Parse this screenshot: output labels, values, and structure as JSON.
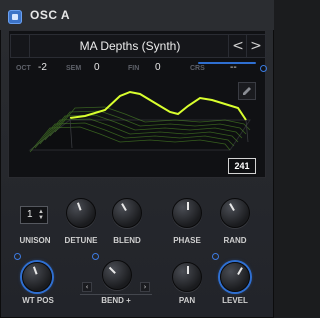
{
  "header": {
    "title": "OSC A"
  },
  "preset": {
    "name": "MA Depths (Synth)",
    "prev": "<",
    "next": ">"
  },
  "params": {
    "oct": {
      "label": "OCT",
      "value": "-2"
    },
    "sem": {
      "label": "SEM",
      "value": "0"
    },
    "fin": {
      "label": "FIN",
      "value": "0"
    },
    "crs": {
      "label": "CRS",
      "value": "--"
    }
  },
  "wavetable": {
    "frame": "241"
  },
  "controls": {
    "unison": {
      "label": "UNISON",
      "value": "1"
    },
    "detune": {
      "label": "DETUNE"
    },
    "blend": {
      "label": "BLEND"
    },
    "phase": {
      "label": "PHASE"
    },
    "rand": {
      "label": "RAND"
    },
    "wtpos": {
      "label": "WT POS"
    },
    "bend": {
      "label": "BEND +"
    },
    "pan": {
      "label": "PAN"
    },
    "level": {
      "label": "LEVEL"
    }
  },
  "colors": {
    "accent": "#2f6fd1",
    "wave": "#d9ff2e",
    "panel": "#24262b"
  }
}
